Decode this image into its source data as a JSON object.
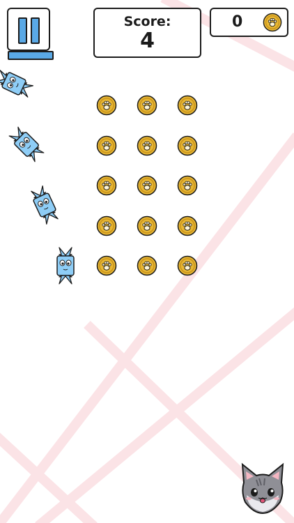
{
  "hud": {
    "score_label": "Score:",
    "score_value": "4",
    "coin_count": "0"
  },
  "icons": {
    "pause": "pause-icon",
    "coin": "paw-coin-icon",
    "candy": "candy-icon",
    "cat": "cat-face-icon"
  },
  "colors": {
    "coin_fill": "#e8b733",
    "coin_ring": "#c8921a",
    "candy_fill": "#8ecdf6",
    "accent_blue": "#5aa9e6",
    "background_lines": "#fbe3e6",
    "cat_gray": "#8f8f96"
  },
  "coin_grid": {
    "rows": 5,
    "cols": 3
  },
  "candies": {
    "count": 4
  }
}
